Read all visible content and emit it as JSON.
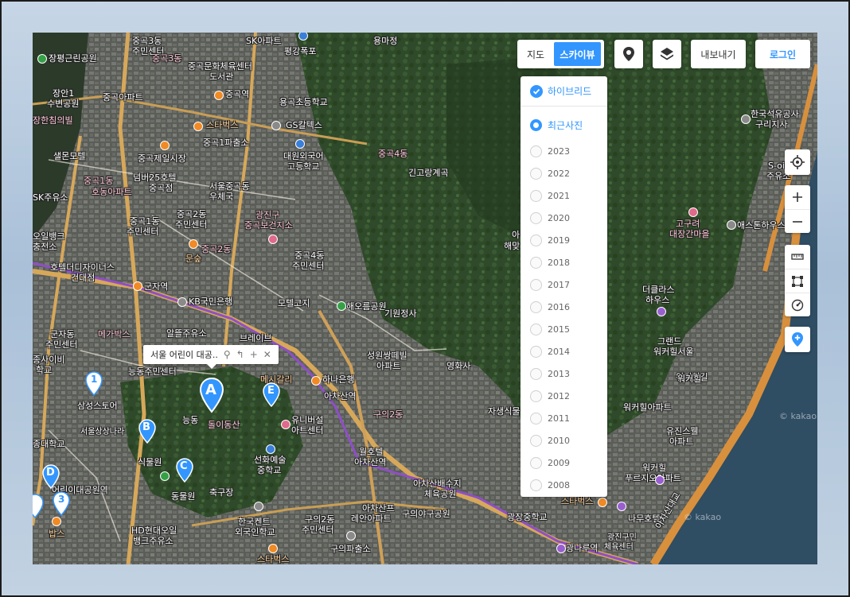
{
  "maptype": {
    "map_label": "지도",
    "skyview_label": "스카이뷰"
  },
  "toolbar": {
    "export_label": "내보내기",
    "login_label": "로그인"
  },
  "colors": {
    "accent": "#3396ff",
    "pin": "#3396ff"
  },
  "dropdown": {
    "hybrid_label": "하이브리드",
    "recent_label": "최근사진",
    "years": [
      "2023",
      "2022",
      "2021",
      "2020",
      "2019",
      "2018",
      "2017",
      "2016",
      "2015",
      "2014",
      "2013",
      "2012",
      "2011",
      "2010",
      "2009",
      "2008"
    ]
  },
  "tooltip": {
    "text": "서울 어린이 대공.."
  },
  "markers": {
    "a": "A",
    "b": "B",
    "c": "C",
    "d": "D",
    "e": "E",
    "n1": "1",
    "n3": "3"
  },
  "watermarks": {
    "w1": "© kakao",
    "w2": "© kakao"
  },
  "labels": {
    "l1": "중곡3동",
    "l2": "주민센터",
    "l3": "SK아파트",
    "l4": "평강폭포",
    "l5": "용마정",
    "l6": "중곡3동",
    "l7": "장평근린공원",
    "l8": "중곡문화체육센터",
    "l9": "도서관",
    "l10": "장안1",
    "l11": "수변공원",
    "l12": "중곡아파트",
    "l13": "중곡역",
    "l14": "용곡초등학교",
    "l15": "한국석유공사",
    "l16": "구리지사",
    "l17": "장한침의빌",
    "l18": "스타벅스",
    "l19": "GS칼텍스",
    "l20": "중곡1파출소",
    "l21": "대원외국어",
    "l22": "고등학교",
    "l23": "중곡4동",
    "l24": "샐몬모텔",
    "l25": "중곡제일시장",
    "l26": "긴고랑계곡",
    "l27": "S-oil",
    "l28": "주유소",
    "l29": "중곡1동",
    "l30": "넘버25호텔",
    "l31": "중곡점",
    "l32": "호동아파트",
    "l33": "서울중곡동",
    "l34": "우체국",
    "l35": "SK주유소",
    "l36": "중곡1동",
    "l37": "주민센터",
    "l38": "중곡2동",
    "l39": "주민센터",
    "l40": "광진구",
    "l41": "중곡보건지소",
    "l42": "고구려",
    "l43": "대장간마을",
    "l44": "애스톤하우스",
    "l45": "오일뱅크",
    "l46": "충전소",
    "l47": "중곡2동",
    "l48": "문숲",
    "l49": "중곡4동",
    "l50": "주민센터",
    "l51": "호텔더디자이너스",
    "l52": "건대점",
    "l53": "군자역",
    "l54": "KB국민은행",
    "l55": "모텔코지",
    "l56": "해오름공원",
    "l57": "더클라스",
    "l58": "하우스",
    "l59": "기원정사",
    "l60": "군자동",
    "l61": "주민센터",
    "l62": "메가박스",
    "l63": "알뜰주유소",
    "l64": "브레이브",
    "l65": "그랜드",
    "l66": "워커힐서울",
    "l67": "종사이비",
    "l68": "학교",
    "l69": "능동주민센터",
    "l70": "성원쌍떼빌",
    "l71": "아파트",
    "l72": "영화사",
    "l73": "워커힐길",
    "l74": "하나은행",
    "l75": "메시갈리",
    "l76": "아차산역",
    "l77": "워커힐",
    "l78": "삼성스토어",
    "l79": "능동",
    "l80": "돌이동산",
    "l81": "유니버설",
    "l82": "아트센터",
    "l83": "구의2동",
    "l84": "자생식물",
    "l85": "워커힐아파트",
    "l86": "서울상상나라",
    "l87": "종대학교",
    "l88": "선화예술",
    "l89": "중학교",
    "l90": "월호텔",
    "l91": "아차산역",
    "l92": "유진스웰",
    "l93": "아파트",
    "l94": "식물원",
    "l95": "아차산배수지",
    "l96": "체육공원",
    "l97": "워커힐",
    "l98": "푸르지오아파트",
    "l99": "어린이대공원역",
    "l100": "동물원",
    "l101": "축구장",
    "l102": "구의야구공원",
    "l103": "스타벅스",
    "l104": "한국켄트",
    "l105": "외국인학교",
    "l106": "구의2동",
    "l107": "주민센터",
    "l108": "아차산프",
    "l109": "레안아파트",
    "l110": "광장중학교",
    "l111": "나무호텔",
    "l112": "광진구민",
    "l113": "체육센터",
    "l114": "아차산대교",
    "l115": "HD현대오일",
    "l116": "뱅크주유소",
    "l117": "구의파출소",
    "l118": "광나루역",
    "l119": "밥스",
    "l120": "스타벅스",
    "l121": "아",
    "l122": "해맞"
  }
}
